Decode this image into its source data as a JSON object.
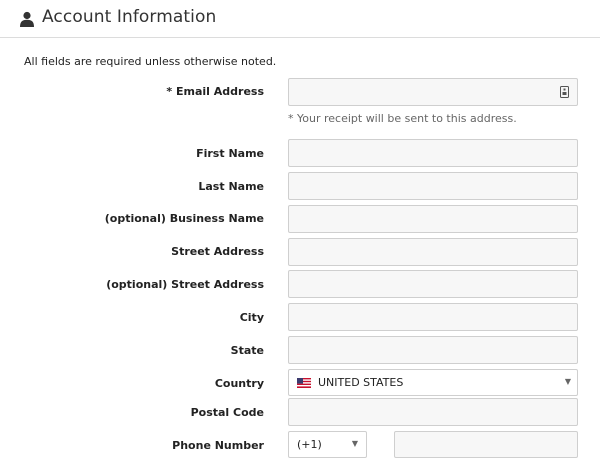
{
  "header": {
    "title": "Account Information",
    "icon": "user-icon"
  },
  "intro": "All fields are required unless otherwise noted.",
  "fields": {
    "email": {
      "label": "* Email Address",
      "value": "",
      "hint": "* Your receipt will be sent to this address."
    },
    "first_name": {
      "label": "First Name",
      "value": ""
    },
    "last_name": {
      "label": "Last Name",
      "value": ""
    },
    "business_name": {
      "label": "(optional) Business Name",
      "value": ""
    },
    "street1": {
      "label": "Street Address",
      "value": ""
    },
    "street2": {
      "label": "(optional) Street Address",
      "value": ""
    },
    "city": {
      "label": "City",
      "value": ""
    },
    "state": {
      "label": "State",
      "value": ""
    },
    "country": {
      "label": "Country",
      "value": "UNITED STATES",
      "flag": "us-flag-icon"
    },
    "postal_code": {
      "label": "Postal Code",
      "value": ""
    },
    "phone": {
      "label": "Phone Number",
      "code": "(+1)",
      "value": ""
    }
  },
  "colors": {
    "field_bg": "#f7f7f7",
    "field_border": "#cfcfcf",
    "divider": "#dcdcdc"
  }
}
